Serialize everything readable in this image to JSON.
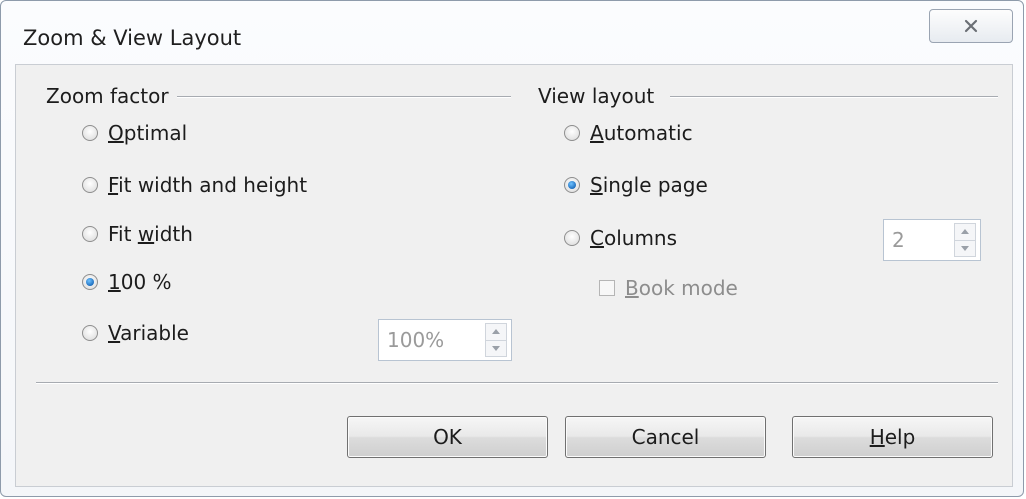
{
  "dialog": {
    "title": "Zoom & View Layout",
    "close_icon": "close-icon"
  },
  "zoom_factor": {
    "heading": "Zoom factor",
    "options": [
      {
        "mnemonic": "O",
        "rest": "ptimal",
        "selected": false
      },
      {
        "mnemonic": "F",
        "rest": "it width and height",
        "selected": false
      },
      {
        "prefix": "Fit ",
        "mnemonic": "w",
        "rest": "idth",
        "selected": false
      },
      {
        "mnemonic": "1",
        "rest": "00 %",
        "selected": true
      },
      {
        "mnemonic": "V",
        "rest": "ariable",
        "selected": false
      }
    ],
    "variable_value": "100%"
  },
  "view_layout": {
    "heading": "View layout",
    "options": [
      {
        "mnemonic": "A",
        "rest": "utomatic",
        "selected": false
      },
      {
        "mnemonic": "S",
        "rest": "ingle page",
        "selected": true
      },
      {
        "mnemonic": "C",
        "rest": "olumns",
        "selected": false
      }
    ],
    "columns_value": "2",
    "book_mode": {
      "mnemonic": "B",
      "rest": "ook mode",
      "checked": false,
      "enabled": false
    }
  },
  "buttons": {
    "ok": "OK",
    "cancel": "Cancel",
    "help_mnemonic": "H",
    "help_rest": "elp"
  },
  "colors": {
    "radio_selected": "#1f6fbf",
    "disabled_text": "#8d8d8d"
  }
}
